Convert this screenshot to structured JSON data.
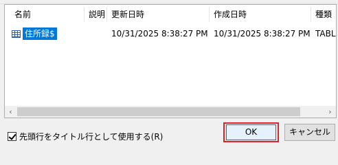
{
  "table": {
    "columns": [
      "名前",
      "説明",
      "更新日時",
      "作成日時",
      "種類"
    ],
    "rows": [
      {
        "name": "住所録$",
        "description": "",
        "modified": "10/31/2025 8:38:27 PM",
        "created": "10/31/2025 8:38:27 PM",
        "type": "TABL"
      }
    ],
    "row_icon": "table-icon"
  },
  "scrollbar": {
    "left_arrow": "‹",
    "right_arrow": "›"
  },
  "options": {
    "first_row_as_title_label": "先頭行をタイトル行として使用する(R)",
    "first_row_as_title_checked": true
  },
  "buttons": {
    "ok_label": "OK",
    "cancel_label": "キャンセル"
  },
  "colors": {
    "selection": "#0078d7",
    "highlight_border": "#d9232d"
  }
}
